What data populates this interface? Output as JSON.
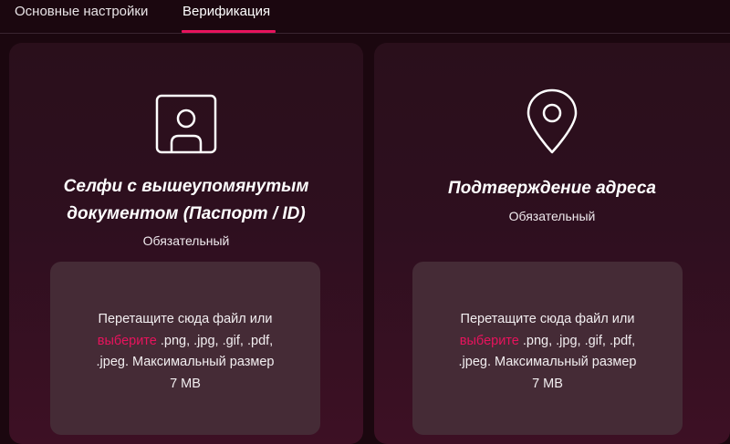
{
  "tabs": {
    "basic_label": "Основные настройки",
    "verification_label": "Верификация",
    "active": "verification"
  },
  "cards": [
    {
      "icon": "id-card-icon",
      "title_line1": "Селфи с вышеупомянутым",
      "title_line2": "документом (Паспорт / ID)",
      "subtitle": "Обязательный",
      "drop": {
        "line1": "Перетащите сюда файл или",
        "link": "выберите",
        "line2": " .png, .jpg, .gif, .pdf,",
        "line3": ".jpeg. Максимальный размер",
        "line4": "7 MB"
      }
    },
    {
      "icon": "location-pin-icon",
      "title_line1": "Подтверждение адреса",
      "subtitle": "Обязательный",
      "drop": {
        "line1": "Перетащите сюда файл или",
        "link": "выберите",
        "line2": " .png, .jpg, .gif, .pdf,",
        "line3": ".jpeg. Максимальный размер",
        "line4": "7 MB"
      }
    }
  ],
  "colors": {
    "background": "#1b070f",
    "accent": "#e8135d",
    "dropzone": "#452b36"
  }
}
